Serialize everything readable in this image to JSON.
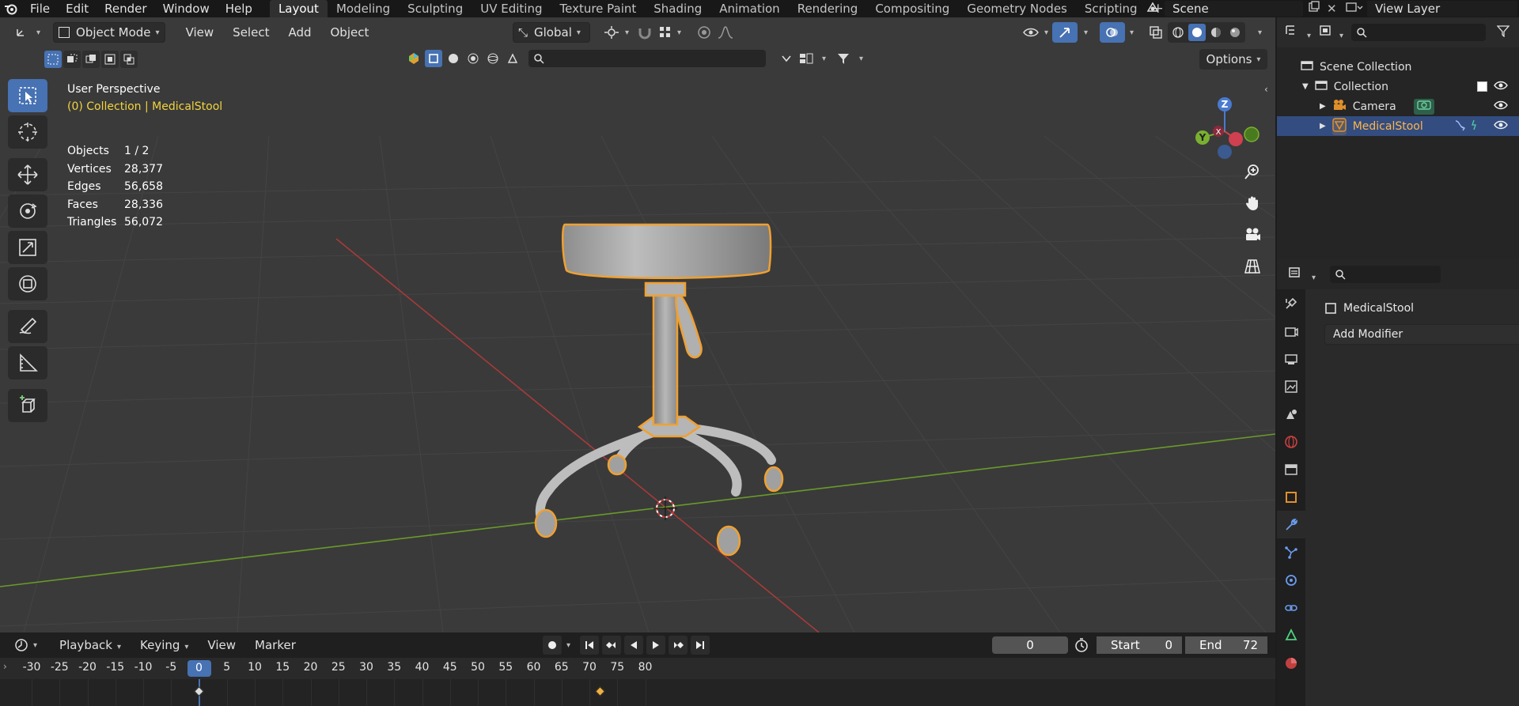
{
  "menu": {
    "items": [
      "File",
      "Edit",
      "Render",
      "Window",
      "Help"
    ]
  },
  "workspaces": {
    "tabs": [
      "Layout",
      "Modeling",
      "Sculpting",
      "UV Editing",
      "Texture Paint",
      "Shading",
      "Animation",
      "Rendering",
      "Compositing",
      "Geometry Nodes",
      "Scripting"
    ],
    "active": "Layout"
  },
  "scene": {
    "name": "Scene"
  },
  "view_layer": {
    "name": "View Layer"
  },
  "viewport": {
    "mode": "Object Mode",
    "menus": [
      "View",
      "Select",
      "Add",
      "Object"
    ],
    "orientation": "Global",
    "options_label": "Options",
    "perspective": "User Perspective",
    "collection_line": "(0) Collection | MedicalStool",
    "stats": [
      {
        "label": "Objects",
        "value": "1 / 2"
      },
      {
        "label": "Vertices",
        "value": "28,377"
      },
      {
        "label": "Edges",
        "value": "56,658"
      },
      {
        "label": "Faces",
        "value": "28,336"
      },
      {
        "label": "Triangles",
        "value": "56,072"
      }
    ],
    "gizmo": {
      "z": "Z",
      "y": "Y",
      "x": "X"
    },
    "colors": {
      "selection_outline": "#f0a030",
      "x_axis": "#c03a3a",
      "y_axis": "#7aa830",
      "active_blue": "#4772b3"
    }
  },
  "timeline": {
    "menus": [
      "Playback",
      "Keying",
      "View",
      "Marker"
    ],
    "current_frame": "0",
    "start_label": "Start",
    "start_value": "0",
    "end_label": "End",
    "end_value": "72",
    "ticks": [
      "-30",
      "-25",
      "-20",
      "-15",
      "-10",
      "-5",
      "0",
      "5",
      "10",
      "15",
      "20",
      "25",
      "30",
      "35",
      "40",
      "45",
      "50",
      "55",
      "60",
      "65",
      "70",
      "75",
      "80"
    ],
    "keyframes": [
      0,
      72
    ]
  },
  "outliner": {
    "scene_collection": "Scene Collection",
    "collection": "Collection",
    "items": [
      {
        "name": "Camera",
        "type": "camera"
      },
      {
        "name": "MedicalStool",
        "type": "mesh",
        "selected": true
      }
    ]
  },
  "properties": {
    "object_name": "MedicalStool",
    "add_modifier": "Add Modifier"
  }
}
